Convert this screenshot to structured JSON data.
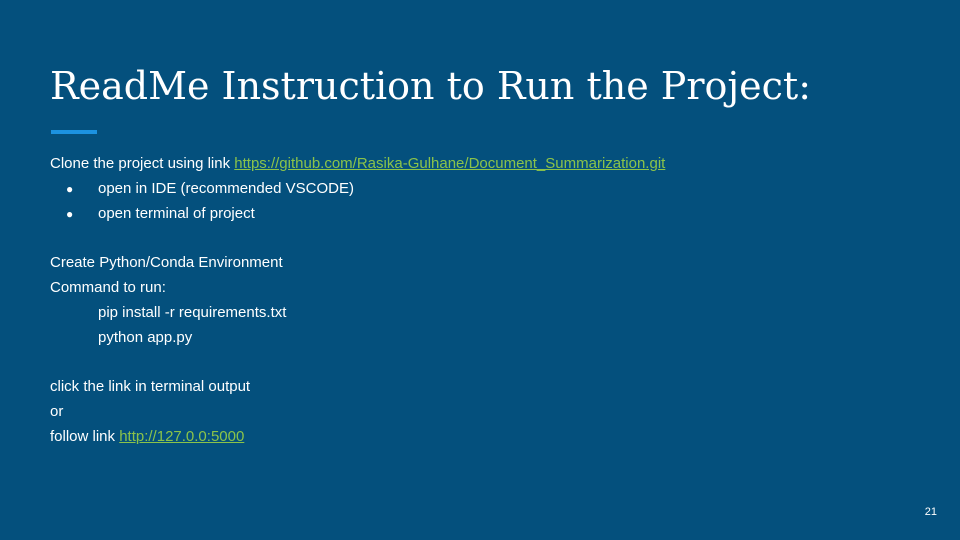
{
  "slide": {
    "title": "ReadMe Instruction to Run the Project:",
    "accent_color": "#1c92e0",
    "background_color": "#04507d",
    "link_color": "#8bc34a",
    "page_number": "21"
  },
  "content": {
    "clone_text": "Clone the project using link ",
    "clone_link": "https://github.com/Rasika-Gulhane/Document_Summarization.git",
    "bullet_symbol": "●",
    "bullets": [
      "open in IDE (recommended  VSCODE)",
      "open terminal of project"
    ],
    "env_line": "Create Python/Conda Environment",
    "command_label": "Command to run:",
    "commands": [
      "pip install -r requirements.txt",
      "python app.py"
    ],
    "click_line": "click the link in terminal output",
    "or_line": "or",
    "follow_text": "follow link ",
    "follow_link": "http://127.0.0:5000"
  }
}
